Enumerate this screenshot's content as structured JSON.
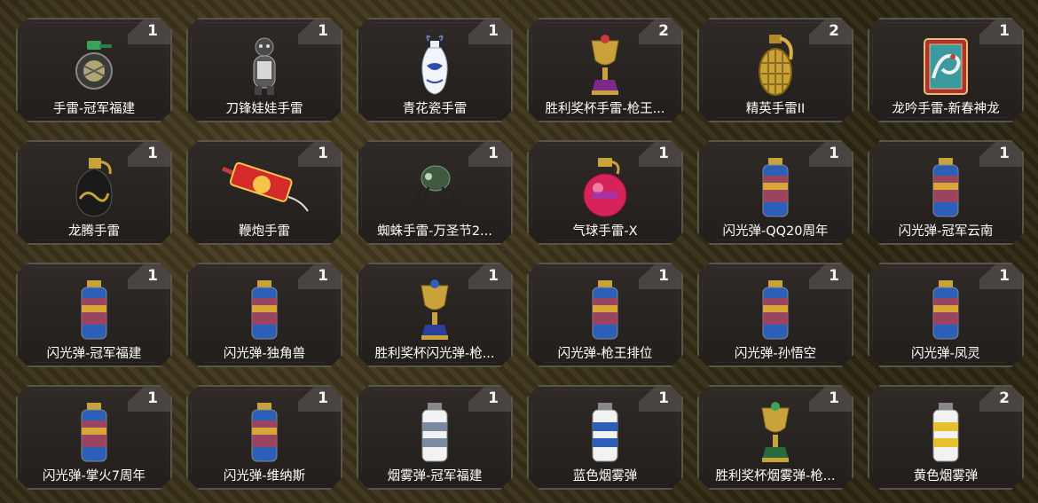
{
  "items": [
    {
      "name": "手雷-冠军福建",
      "count": "1",
      "icon": "grenade-green-icon"
    },
    {
      "name": "刀锋娃娃手雷",
      "count": "1",
      "icon": "doll-grenade-icon"
    },
    {
      "name": "青花瓷手雷",
      "count": "1",
      "icon": "porcelain-vase-icon"
    },
    {
      "name": "胜利奖杯手雷-枪王...",
      "count": "2",
      "icon": "trophy-grenade-icon"
    },
    {
      "name": "精英手雷II",
      "count": "2",
      "icon": "gold-grenade-icon"
    },
    {
      "name": "龙吟手雷-新春神龙",
      "count": "1",
      "icon": "dragon-box-icon"
    },
    {
      "name": "龙腾手雷",
      "count": "1",
      "icon": "dragon-grenade-icon"
    },
    {
      "name": "鞭炮手雷",
      "count": "1",
      "icon": "firecracker-icon"
    },
    {
      "name": "蜘蛛手雷-万圣节2...",
      "count": "1",
      "icon": "spider-grenade-icon"
    },
    {
      "name": "气球手雷-X",
      "count": "1",
      "icon": "balloon-grenade-icon"
    },
    {
      "name": "闪光弹-QQ20周年",
      "count": "1",
      "icon": "flashbang-icon"
    },
    {
      "name": "闪光弹-冠军云南",
      "count": "1",
      "icon": "flashbang-icon"
    },
    {
      "name": "闪光弹-冠军福建",
      "count": "1",
      "icon": "flashbang-icon"
    },
    {
      "name": "闪光弹-独角兽",
      "count": "1",
      "icon": "flashbang-icon"
    },
    {
      "name": "胜利奖杯闪光弹-枪...",
      "count": "1",
      "icon": "trophy-flashbang-icon"
    },
    {
      "name": "闪光弹-枪王排位",
      "count": "1",
      "icon": "flashbang-icon"
    },
    {
      "name": "闪光弹-孙悟空",
      "count": "1",
      "icon": "flashbang-icon"
    },
    {
      "name": "闪光弹-凤灵",
      "count": "1",
      "icon": "flashbang-icon"
    },
    {
      "name": "闪光弹-掌火7周年",
      "count": "1",
      "icon": "flashbang-icon"
    },
    {
      "name": "闪光弹-维纳斯",
      "count": "1",
      "icon": "flashbang-icon"
    },
    {
      "name": "烟雾弹-冠军福建",
      "count": "1",
      "icon": "smoke-grenade-icon"
    },
    {
      "name": "蓝色烟雾弹",
      "count": "1",
      "icon": "smoke-grenade-icon"
    },
    {
      "name": "胜利奖杯烟雾弹-枪...",
      "count": "1",
      "icon": "trophy-smoke-icon"
    },
    {
      "name": "黄色烟雾弹",
      "count": "2",
      "icon": "smoke-grenade-icon"
    }
  ],
  "colors": {
    "accent_green": "#3aa35a",
    "gold": "#c9a23a",
    "red": "#c83a3a",
    "blue": "#2c5fb8",
    "yellow": "#e6c12e"
  }
}
